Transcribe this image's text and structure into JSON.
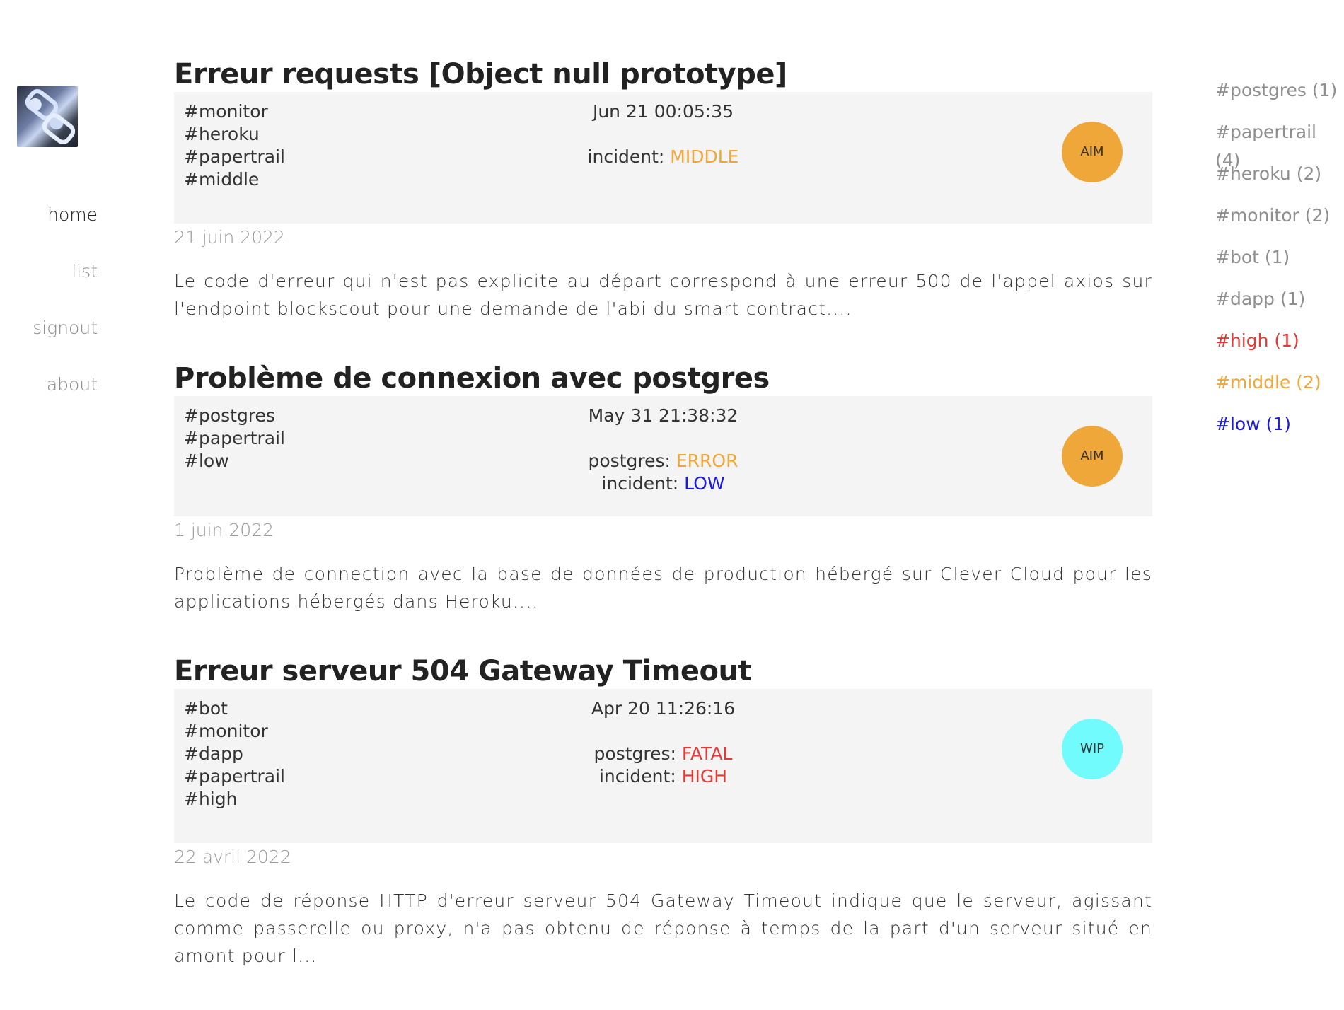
{
  "nav": {
    "home": "home",
    "list": "list",
    "signout": "signout",
    "about": "about"
  },
  "posts": [
    {
      "title": "Erreur requests [Object null prototype]",
      "tags": [
        "#monitor",
        "#heroku",
        "#papertrail",
        "#middle"
      ],
      "time": "Jun 21 00:05:35",
      "status_lines": [
        {
          "label": "incident: ",
          "value": "MIDDLE",
          "color": "#f0a73a"
        }
      ],
      "avatar": {
        "label": "AIM",
        "color": "#f0a73a"
      },
      "date": "21 juin 2022",
      "excerpt": "Le code d'erreur qui n'est pas explicite au départ correspond à une erreur 500 de l'appel axios sur l'endpoint blockscout pour une demande de l'abi du smart contract...."
    },
    {
      "title": "Problème de connexion avec postgres",
      "tags": [
        "#postgres",
        "#papertrail",
        "#low"
      ],
      "time": "May 31 21:38:32",
      "status_lines": [
        {
          "label": "postgres: ",
          "value": "ERROR",
          "color": "#f0a73a"
        },
        {
          "label": "incident: ",
          "value": "LOW",
          "color": "#1a1ae0"
        }
      ],
      "avatar": {
        "label": "AIM",
        "color": "#f0a73a"
      },
      "date": "1 juin 2022",
      "excerpt": "Problème de connection avec la base de données de production hébergé sur Clever Cloud pour les applications hébergés dans Heroku...."
    },
    {
      "title": "Erreur serveur 504 Gateway Timeout",
      "tags": [
        "#bot",
        "#monitor",
        "#dapp",
        "#papertrail",
        "#high"
      ],
      "time": "Apr 20 11:26:16",
      "status_lines": [
        {
          "label": "postgres: ",
          "value": "FATAL",
          "color": "#e53935"
        },
        {
          "label": "incident: ",
          "value": "HIGH",
          "color": "#e53935"
        }
      ],
      "avatar": {
        "label": "WIP",
        "color": "#72fbfd"
      },
      "date": "22 avril 2022",
      "excerpt": "Le code de réponse HTTP d'erreur serveur 504 Gateway Timeout indique que le serveur, agissant comme passerelle ou proxy, n'a pas obtenu de réponse à temps de la part d'un serveur situé en amont pour l..."
    }
  ],
  "tagcloud": [
    {
      "label": "#postgres (1)",
      "color": "#8f8f8f"
    },
    {
      "label": "#papertrail (4)",
      "color": "#8f8f8f"
    },
    {
      "label": "#heroku (2)",
      "color": "#8f8f8f"
    },
    {
      "label": "#monitor (2)",
      "color": "#8f8f8f"
    },
    {
      "label": "#bot (1)",
      "color": "#8f8f8f"
    },
    {
      "label": "#dapp (1)",
      "color": "#8f8f8f"
    },
    {
      "label": "#high (1)",
      "color": "#e53935"
    },
    {
      "label": "#middle (2)",
      "color": "#f0a73a"
    },
    {
      "label": "#low (1)",
      "color": "#1a1ae0"
    }
  ]
}
